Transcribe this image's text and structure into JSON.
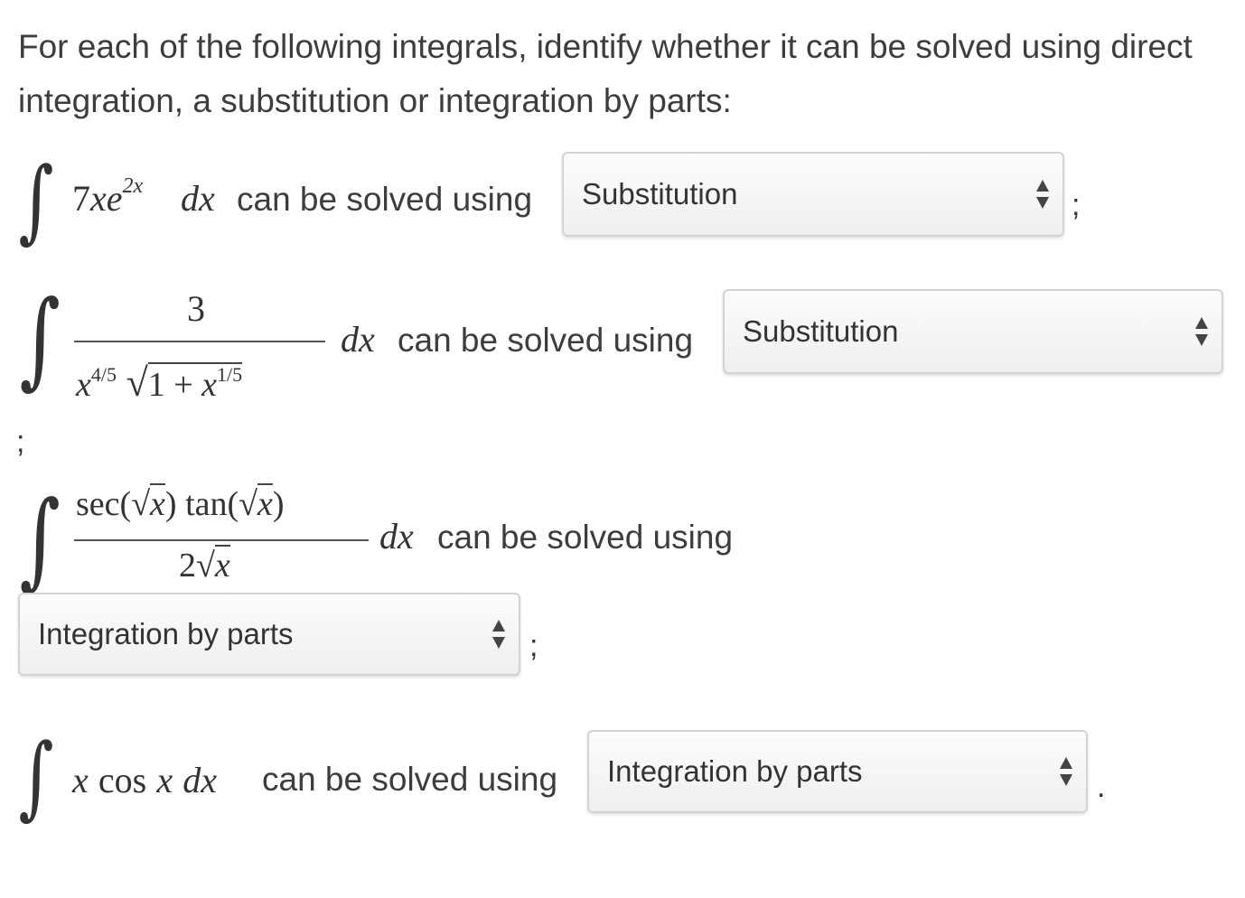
{
  "prompt": "For each of the following integrals, identify whether it can be solved using direct integration, a substitution or integration by parts:",
  "phrase": "can be solved using",
  "questions": [
    {
      "coef": "7",
      "x": "x",
      "e": "e",
      "exp": "2x",
      "dx": "dx",
      "selected": "Substitution",
      "after": ";"
    },
    {
      "numerator": "3",
      "den_x": "x",
      "den_exp1": "4/5",
      "den_radicand": "1 + ",
      "den_x2": "x",
      "den_exp2": "1/5",
      "dx": "dx",
      "selected": "Substitution",
      "after": ";"
    },
    {
      "num_sec": "sec(",
      "num_x1": "x",
      "num_mid": ") tan(",
      "num_x2": "x",
      "num_end": ")",
      "den_two": "2",
      "den_x": "x",
      "dx": "dx",
      "selected": "Integration by parts",
      "after": ";"
    },
    {
      "x1": "x",
      "cos": "cos",
      "x2": "x",
      "dx": "dx",
      "selected": "Integration by parts",
      "after": "."
    }
  ],
  "icons": {
    "select_arrows": "up-down-arrows-icon"
  },
  "colors": {
    "text": "#3d3d3d",
    "select_border": "#d3d3d3"
  }
}
